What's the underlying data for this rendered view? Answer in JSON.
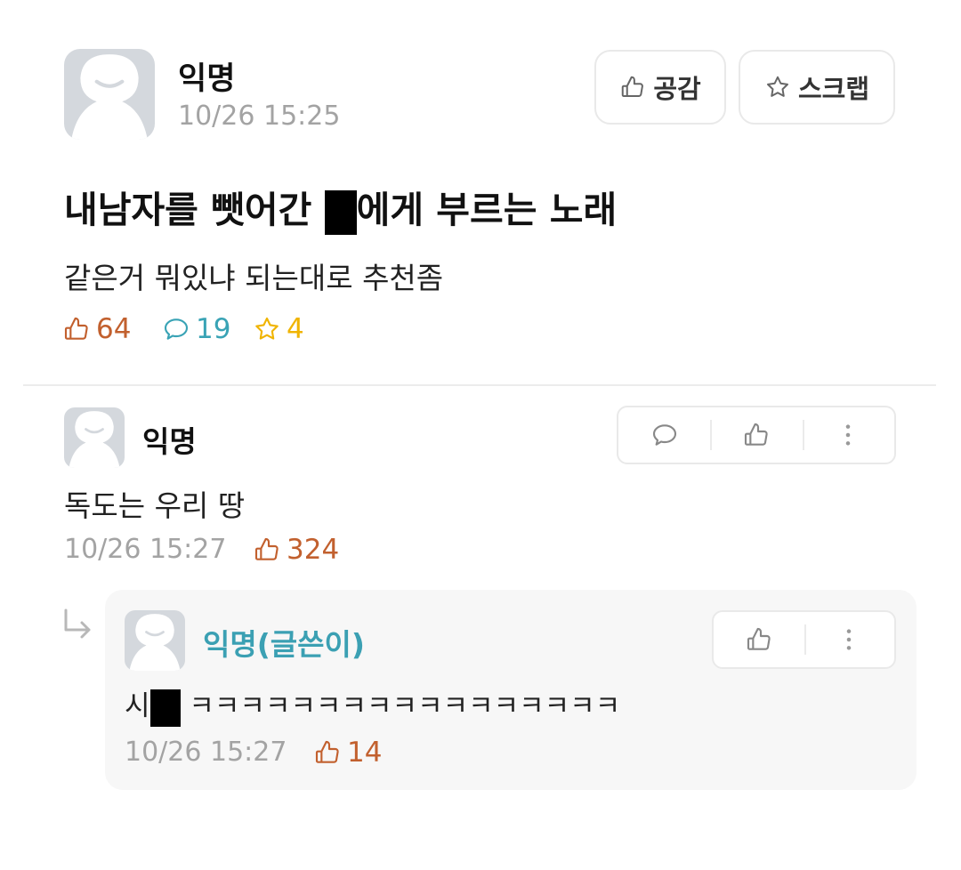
{
  "post": {
    "author": "익명",
    "time": "10/26 15:25",
    "title_before": "내남자를 뺏어간 ",
    "title_after": "에게 부르는 노래",
    "body": "같은거 뭐있냐 되는대로 추천좀",
    "like_button_label": "공감",
    "scrap_button_label": "스크랩",
    "stats": {
      "likes": "64",
      "comments": "19",
      "scraps": "4"
    }
  },
  "comment": {
    "author": "익명",
    "text": "독도는 우리 땅",
    "time": "10/26 15:27",
    "likes": "324"
  },
  "reply": {
    "author": "익명(글쓴이)",
    "text_before": "시",
    "text_after": " ㅋㅋㅋㅋㅋㅋㅋㅋㅋㅋㅋㅋㅋㅋㅋㅋㅋ",
    "time": "10/26 15:27",
    "likes": "14"
  },
  "colors": {
    "like": "#c2602e",
    "comment": "#39a3b5",
    "scrap": "#f0b400",
    "author_reply": "#3ba0b3",
    "meta": "#a3a3a3"
  },
  "icons": [
    "thumbs-up-icon",
    "star-icon",
    "speech-bubble-icon",
    "more-vertical-icon",
    "reply-arrow-icon",
    "avatar-placeholder-icon"
  ]
}
